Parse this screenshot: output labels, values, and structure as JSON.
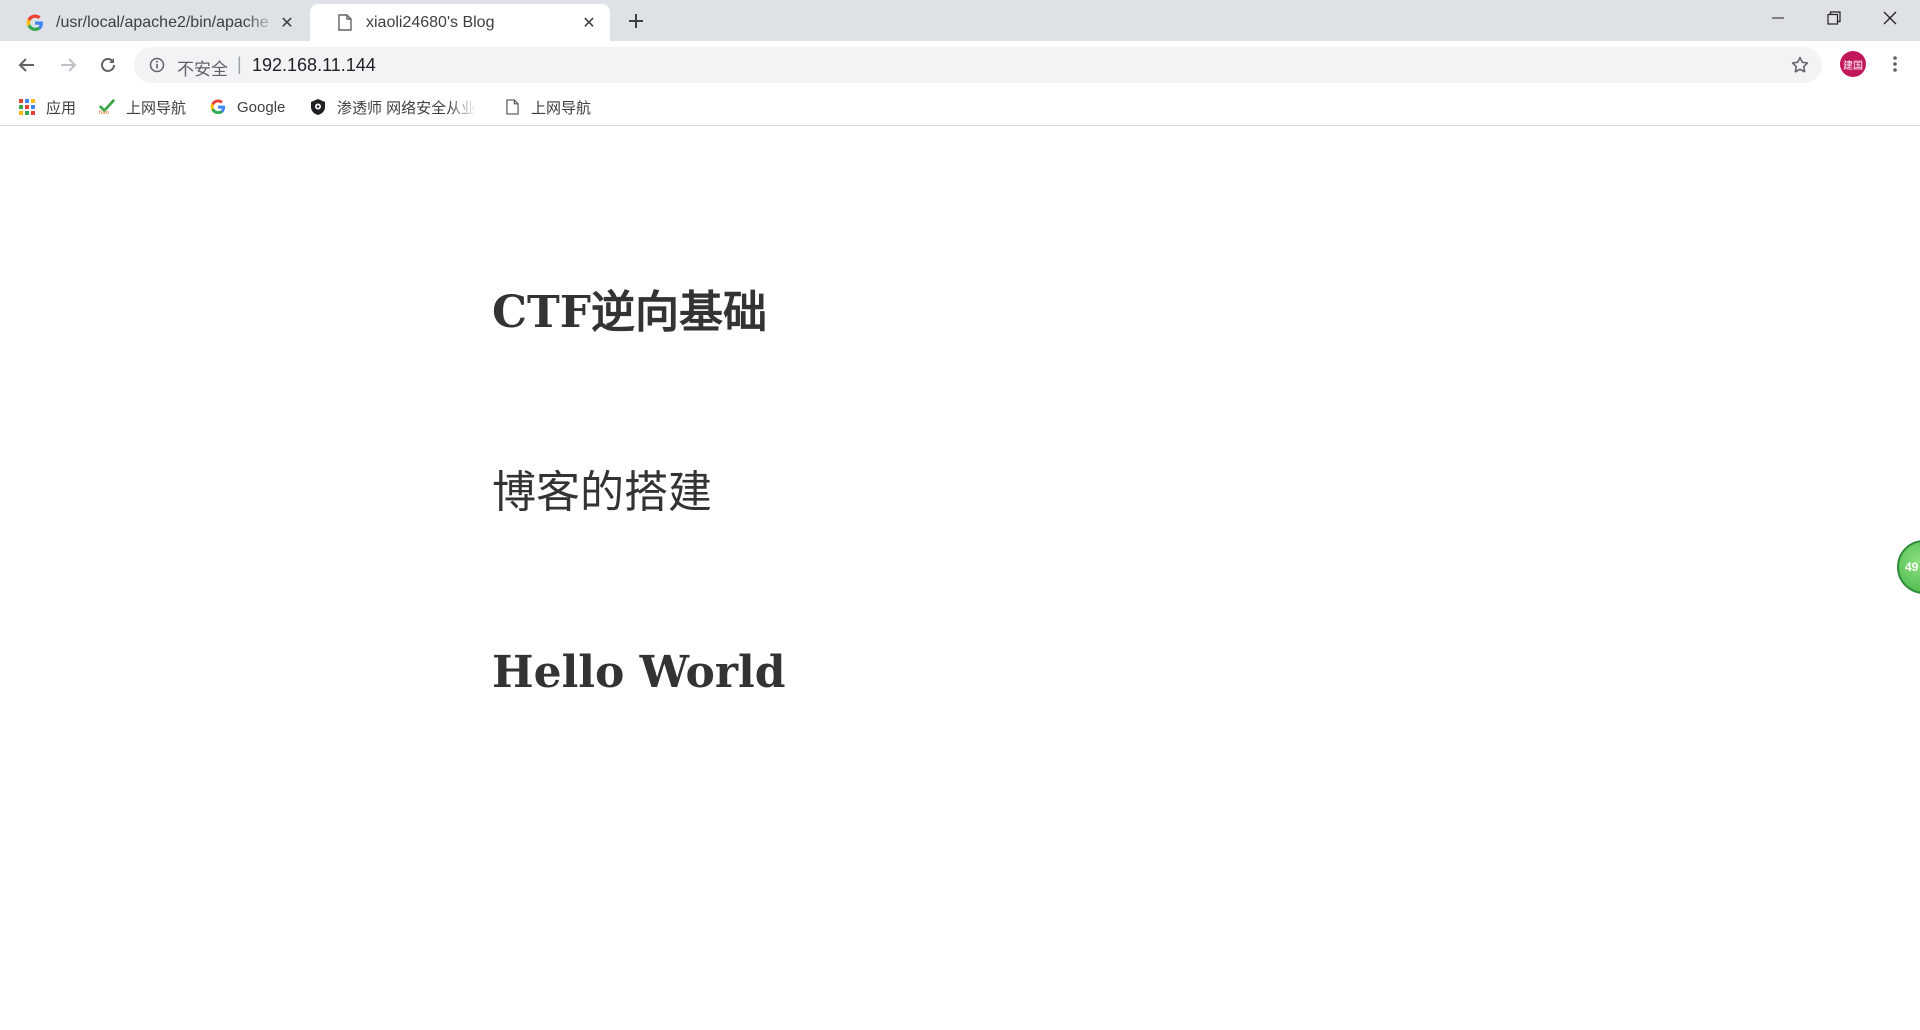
{
  "browser": {
    "tabs": [
      {
        "title": "/usr/local/apache2/bin/apache",
        "favicon": "google-g-icon",
        "active": false
      },
      {
        "title": "xiaoli24680's Blog",
        "favicon": "page-icon",
        "active": true
      }
    ],
    "address_bar": {
      "security_label": "不安全",
      "separator": "|",
      "url": "192.168.11.144"
    },
    "profile_avatar_text": "建国",
    "bookmarks": [
      {
        "label": "应用",
        "icon": "apps-grid-icon"
      },
      {
        "label": "上网导航",
        "icon": "hao-check-icon"
      },
      {
        "label": "Google",
        "icon": "google-g-icon"
      },
      {
        "label": "渗透师 网络安全从业",
        "icon": "shield-icon"
      },
      {
        "label": "上网导航",
        "icon": "page-icon"
      }
    ]
  },
  "page": {
    "posts": [
      {
        "title": "CTF逆向基础"
      },
      {
        "title": "博客的搭建"
      },
      {
        "title": "Hello World"
      }
    ],
    "floating_widget_text": "49"
  },
  "colors": {
    "tabstrip_bg": "#dee1e6",
    "omnibox_bg": "#f1f3f4",
    "post_title": "#333333",
    "avatar_bg": "#c2185b",
    "widget_green": "#3cb043"
  }
}
